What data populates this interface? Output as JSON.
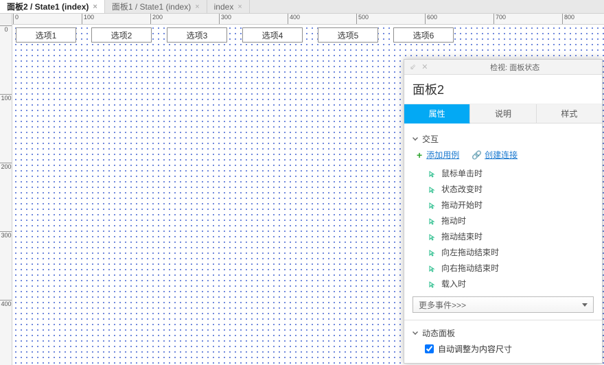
{
  "tabs": [
    {
      "label": "面板2 / State1 (index)",
      "active": true
    },
    {
      "label": "面板1 / State1 (index)",
      "active": false
    },
    {
      "label": "index",
      "active": false
    }
  ],
  "hruler_ticks": [
    0,
    100,
    200,
    300,
    400,
    500,
    600,
    700,
    800
  ],
  "vruler_ticks": [
    0,
    100,
    200,
    300,
    400
  ],
  "canvas": {
    "options": [
      "选项1",
      "选项2",
      "选项3",
      "选项4",
      "选项5",
      "选项6"
    ]
  },
  "inspector": {
    "title": "检视: 面板状态",
    "element_name": "面板2",
    "tabs": [
      "属性",
      "说明",
      "样式"
    ],
    "active_tab_index": 0,
    "section_interaction": "交互",
    "add_case_label": "添加用例",
    "create_link_label": "创建连接",
    "events": [
      "鼠标单击时",
      "状态改变时",
      "拖动开始时",
      "拖动时",
      "拖动结束时",
      "向左拖动结束时",
      "向右拖动结束时",
      "载入时"
    ],
    "more_events_label": "更多事件>>>",
    "section_dynamic_panel": "动态面板",
    "auto_fit_label": "自动调整为内容尺寸",
    "auto_fit_checked": true
  }
}
